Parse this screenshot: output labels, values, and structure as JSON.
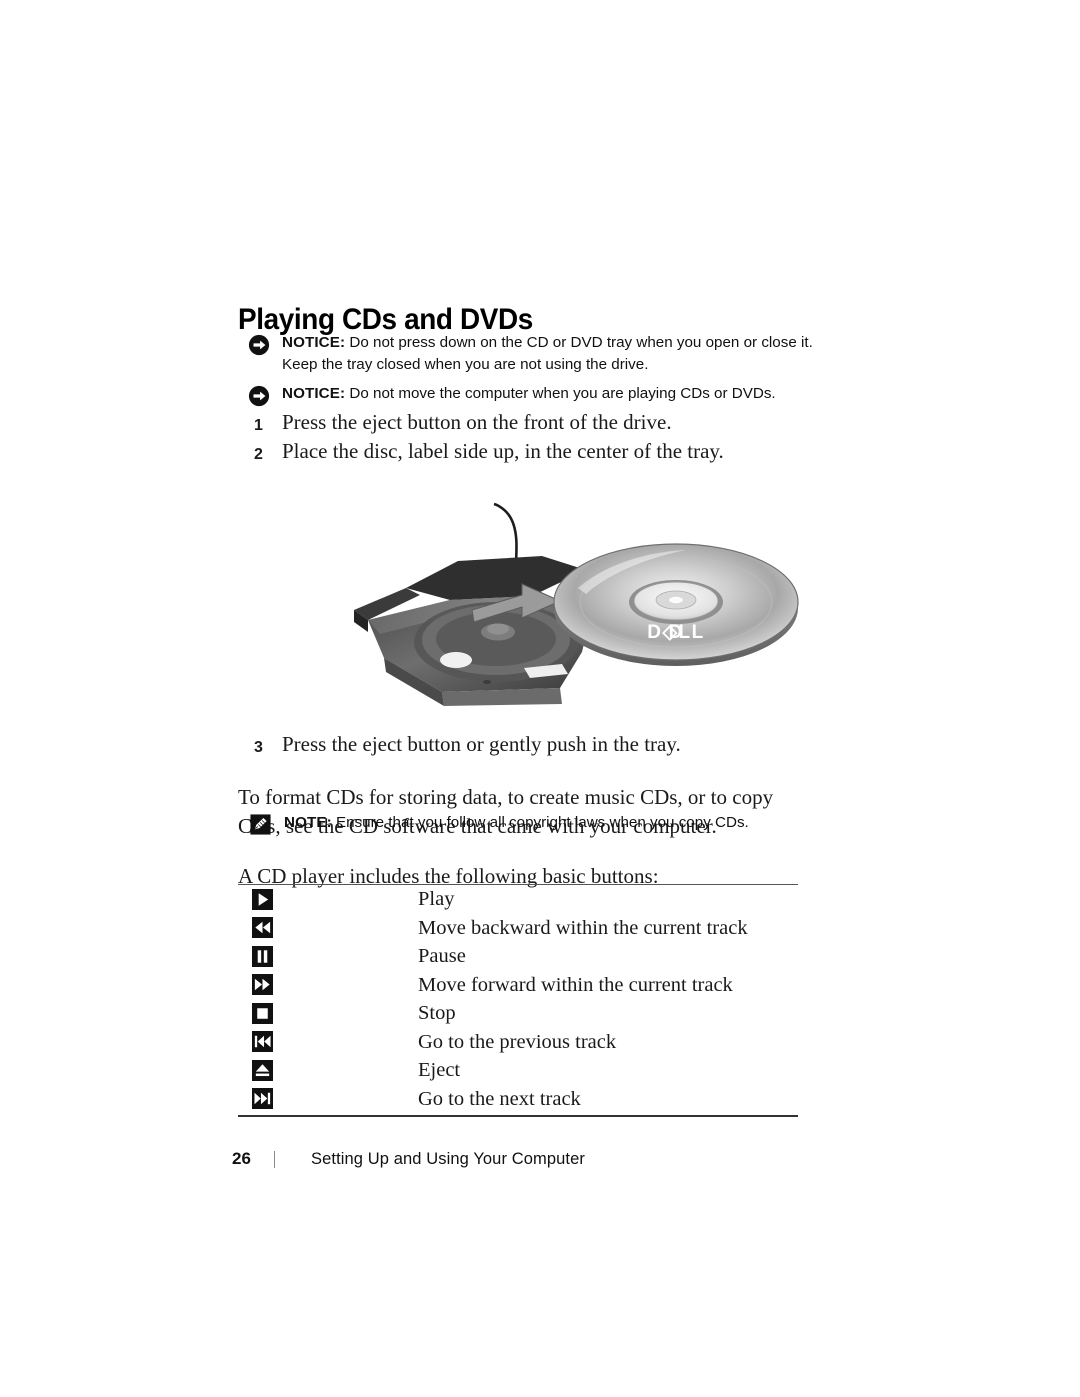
{
  "document": {
    "heading": "Playing CDs and DVDs",
    "notices": [
      {
        "icon": "notice-arrow-icon",
        "label": "NOTICE:",
        "text": " Do not press down on the CD or DVD tray when you open or close it. Keep the tray closed when you are not using the drive."
      },
      {
        "icon": "notice-arrow-icon",
        "label": "NOTICE:",
        "text": " Do not move the computer when you are playing CDs or DVDs."
      }
    ],
    "note": {
      "icon": "note-pencil-icon",
      "label": "NOTE:",
      "text": " Ensure that you follow all copyright laws when you copy CDs."
    },
    "steps": [
      {
        "num": "1",
        "text": "Press the eject button on the front of the drive."
      },
      {
        "num": "2",
        "text": "Place the disc, label side up, in the center of the tray."
      },
      {
        "num": "3",
        "text": "Press the eject button or gently push in the tray."
      }
    ],
    "paragraphs": {
      "format": "To format CDs for storing data, to create music CDs, or to copy CDs, see the CD software that came with your computer.",
      "buttons_intro": "A CD player includes the following basic buttons:"
    },
    "figure": {
      "name": "optical-drive-tray-with-disc",
      "disc_label": "DELL"
    },
    "button_table": {
      "rows": [
        {
          "icon": "play-icon",
          "label": "Play"
        },
        {
          "icon": "rewind-icon",
          "label": "Move backward within the current track"
        },
        {
          "icon": "pause-icon",
          "label": "Pause"
        },
        {
          "icon": "fast-forward-icon",
          "label": "Move forward within the current track"
        },
        {
          "icon": "stop-icon",
          "label": "Stop"
        },
        {
          "icon": "previous-track-icon",
          "label": "Go to the previous track"
        },
        {
          "icon": "eject-icon",
          "label": "Eject"
        },
        {
          "icon": "next-track-icon",
          "label": "Go to the next track"
        }
      ]
    },
    "footer": {
      "page_number": "26",
      "section_name": "Setting Up and Using Your Computer"
    },
    "colors": {
      "text": "#1a1a1a",
      "icon_fill": "#111111",
      "rule": "#555555"
    }
  }
}
